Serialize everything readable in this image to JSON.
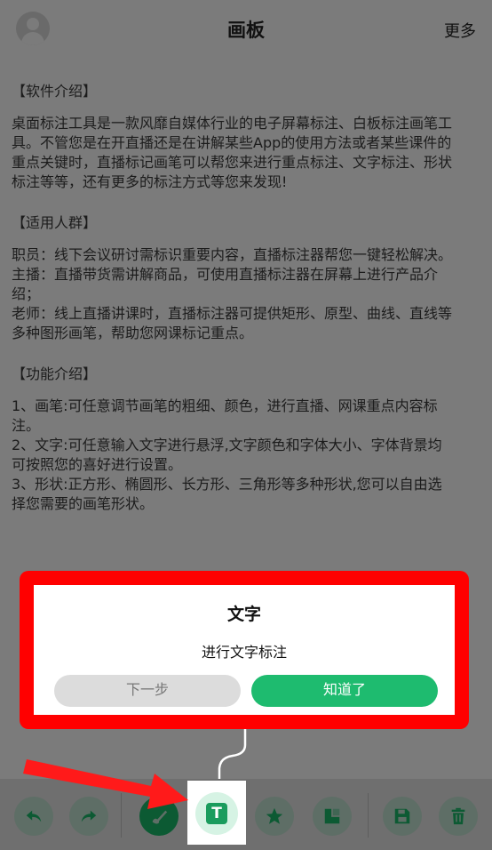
{
  "header": {
    "title": "画板",
    "more_label": "更多",
    "avatar_icon": "user-avatar-icon"
  },
  "content": {
    "section1_heading": "【软件介绍】",
    "section1_lines": [
      "桌面标注工具是一款风靡自媒体行业的电子屏幕标注、白板标注画笔工",
      "具。不管您是在开直播还是在讲解某些App的使用方法或者某些课件的",
      "重点关键时，直播标记画笔可以帮您来进行重点标注、文字标注、形状",
      "标注等等，还有更多的标注方式等您来发现!"
    ],
    "section2_heading": "【适用人群】",
    "section2_lines": [
      "职员：线下会议研讨需标识重要内容，直播标注器帮您一键轻松解决。",
      "主播：直播带货需讲解商品，可使用直播标注器在屏幕上进行产品介",
      "绍；",
      "老师：线上直播讲课时，直播标注器可提供矩形、原型、曲线、直线等",
      "多种图形画笔，帮助您网课标记重点。"
    ],
    "section3_heading": "【功能介绍】",
    "section3_lines": [
      "1、画笔:可任意调节画笔的粗细、颜色，进行直播、网课重点内容标",
      "注。",
      "2、文字:可任意输入文字进行悬浮,文字颜色和字体大小、字体背景均",
      "可按照您的喜好进行设置。",
      "3、形状:正方形、椭圆形、长方形、三角形等多种形状,您可以自由选",
      "择您需要的画笔形状。"
    ]
  },
  "dialog": {
    "title": "文字",
    "message": "进行文字标注",
    "next_label": "下一步",
    "ok_label": "知道了"
  },
  "toolbar": {
    "tools": [
      "undo-icon",
      "redo-icon",
      "brush-icon",
      "text-icon",
      "star-shape-icon",
      "crop-icon",
      "save-icon",
      "trash-icon"
    ],
    "text_tool_glyph": "T"
  },
  "colors": {
    "accent": "#1ebb6f",
    "highlight": "#ff0000",
    "overlay": "#7b7b7b"
  }
}
